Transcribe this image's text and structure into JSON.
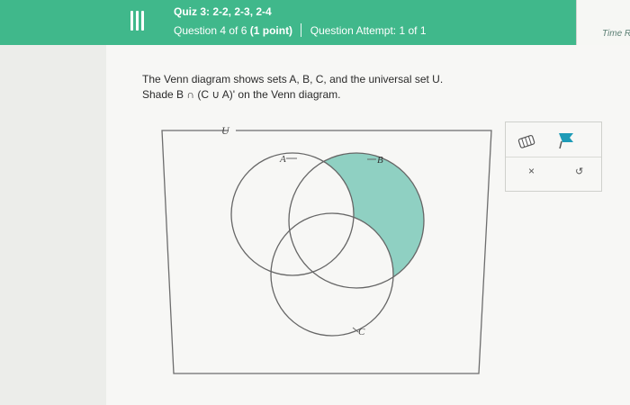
{
  "header": {
    "quiz_title": "Quiz 3: 2-2, 2-3, 2-4",
    "question_position": "Question 4 of 6",
    "question_points": "(1 point)",
    "attempt": "Question Attempt: 1 of 1",
    "time_label": "Time R"
  },
  "question": {
    "line1": "The Venn diagram shows sets A, B, C, and the universal set U.",
    "line2": "Shade B ∩ (C ∪ A)' on the Venn diagram."
  },
  "venn": {
    "universal_label": "U",
    "set_labels": {
      "a": "A",
      "b": "B",
      "c": "C"
    },
    "shade_color": "#8fd0c2"
  },
  "tools": {
    "shade_tool": "paint-bucket-icon",
    "flag_tool": "flag-icon",
    "clear_symbol": "×",
    "undo_symbol": "↺"
  },
  "colors": {
    "header": "#40b88b",
    "flag": "#1e9bb7"
  }
}
